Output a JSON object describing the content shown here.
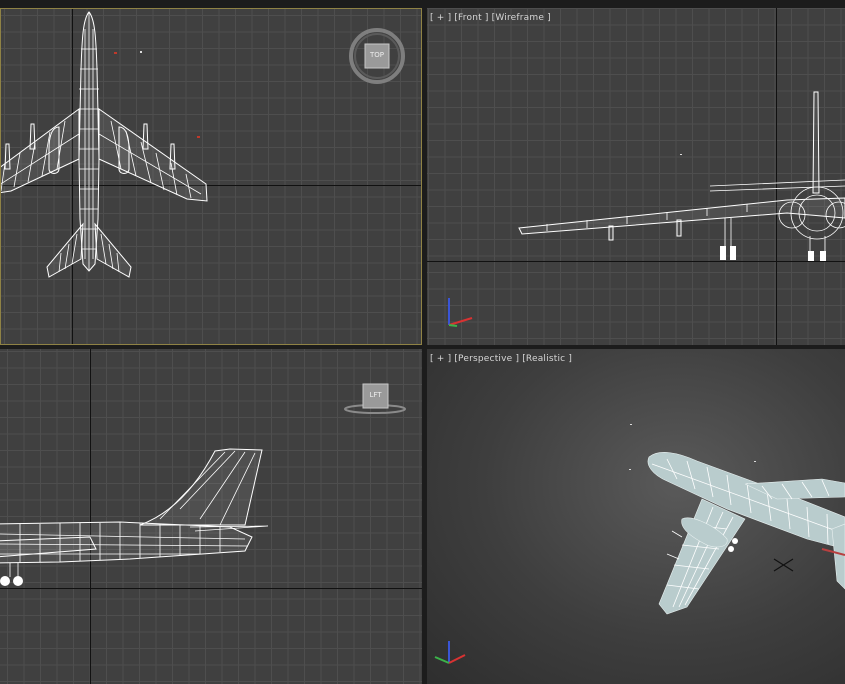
{
  "viewports": {
    "top": {
      "label": "",
      "viewcube_face": "TOP"
    },
    "front": {
      "label": "[ + ] [Front ] [Wireframe ]"
    },
    "left": {
      "label": "",
      "viewcube_face": "LFT"
    },
    "perspective": {
      "label": "[ + ] [Perspective ] [Realistic ]"
    }
  },
  "axis_gizmo": {
    "x": "x",
    "y": "y",
    "z": "z"
  },
  "colors": {
    "viewport_bg": "#404040",
    "grid": "#4e4e4e",
    "active_border": "#8f8245",
    "wireframe": "#ffffff",
    "x_axis": "#d93232",
    "y_axis": "#3bb34a",
    "z_axis": "#3a55d6"
  }
}
